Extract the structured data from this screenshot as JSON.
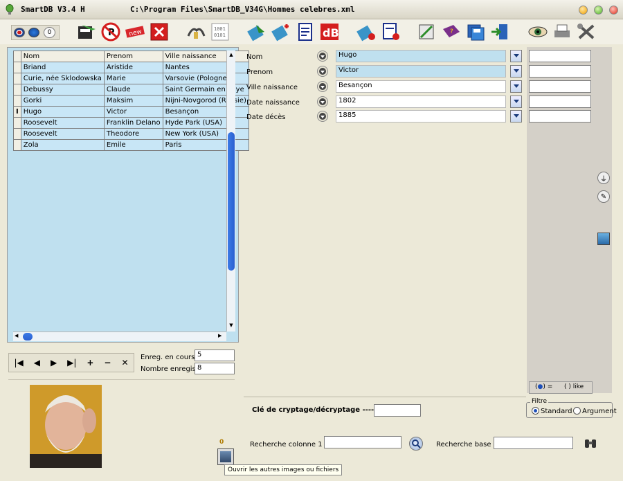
{
  "window": {
    "app_title": "SmartDB  V3.4 H",
    "file_path": "C:\\Program Files\\SmartDB_V34G\\Hommes celebres.xml"
  },
  "toolbar": {
    "counter_label": "0",
    "new_badge": "new",
    "db_label": "dB"
  },
  "grid": {
    "columns": [
      "Nom",
      "Prenom",
      "Ville naissance"
    ],
    "rows": [
      [
        "Briand",
        "Aristide",
        "Nantes"
      ],
      [
        "Curie, née Sklodowska",
        "Marie",
        "Varsovie (Pologne)"
      ],
      [
        "Debussy",
        "Claude",
        "Saint Germain en Laye"
      ],
      [
        "Gorki",
        "Maksim",
        "Nijni-Novgorod (Russie)"
      ],
      [
        "Hugo",
        "Victor",
        "Besançon"
      ],
      [
        "Roosevelt",
        "Franklin Delano",
        "Hyde Park (USA)"
      ],
      [
        "Roosevelt",
        "Theodore",
        "New York (USA)"
      ],
      [
        "Zola",
        "Emile",
        "Paris"
      ]
    ],
    "current_row_index": 4
  },
  "navigator": {
    "first": "|◀",
    "prev": "◀",
    "next": "▶",
    "last": "▶|",
    "add": "+",
    "remove": "−",
    "cancel": "✕",
    "current_label": "Enreg. en cours",
    "current_value": "5",
    "count_label": "Nombre enregistr.",
    "count_value": "8"
  },
  "image_panel": {
    "image_count": "0",
    "tooltip": "Ouvrir les autres images ou fichiers"
  },
  "form": {
    "fields": [
      {
        "label": "Nom",
        "value": "Hugo"
      },
      {
        "label": "Prenom",
        "value": "Victor"
      },
      {
        "label": "Ville naissance",
        "value": "Besançon"
      },
      {
        "label": "Date naissance",
        "value": "1802"
      },
      {
        "label": "Date décès",
        "value": "1885"
      }
    ]
  },
  "search_mode": {
    "equals_label": "=",
    "like_label": "like"
  },
  "crypt": {
    "label": "Clé de cryptage/décryptage ---->",
    "value": ""
  },
  "filter": {
    "legend": "Filtre",
    "standard_label": "Standard",
    "argument_label": "Argument"
  },
  "search": {
    "column_label": "Recherche colonne 1",
    "column_value": "",
    "base_label": "Recherche base",
    "base_value": ""
  },
  "colors": {
    "selected_field": "#bfe0ef",
    "grid_background": "#bfe0ef",
    "window_background": "#ece9d8"
  }
}
